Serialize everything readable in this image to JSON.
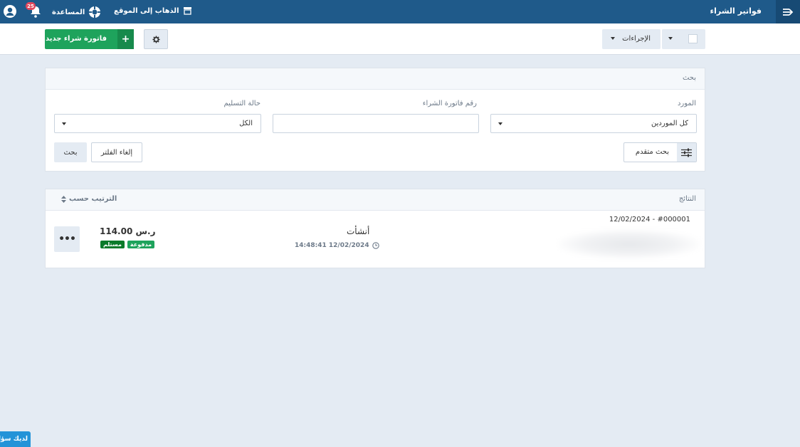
{
  "header": {
    "title": "فواتير الشراء",
    "go_to_site": "الذهاب إلى الموقع",
    "help": "المساعدة",
    "notifications_count": "25"
  },
  "toolbar": {
    "new_invoice_label": "فاتورة شراء جديد",
    "actions_label": "الإجراءات"
  },
  "search": {
    "title": "بحث",
    "supplier_label": "المورد",
    "supplier_value": "كل الموردين",
    "invoice_number_label": "رقم فاتورة الشراء",
    "invoice_number_value": "",
    "delivery_status_label": "حالة التسليم",
    "delivery_status_value": "الكل",
    "advanced_search_label": "بحث متقدم",
    "clear_filter_label": "إلغاء الفلتر",
    "search_button_label": "بحث"
  },
  "results": {
    "title": "النتائج",
    "sort_label": "الترتيب حسب",
    "rows": [
      {
        "ref": "12/02/2024 - #000001",
        "status": "أنشأت",
        "timestamp": "14:48:41 12/02/2024",
        "amount": "114.00 ر.س",
        "tag_paid": "مدفوعة",
        "tag_received": "مستلم"
      }
    ]
  },
  "chat": {
    "label": "لديك سؤال"
  },
  "colors": {
    "header": "#1f5a8a",
    "primary_green": "#1ea35c",
    "badge_red": "#e0475d"
  }
}
